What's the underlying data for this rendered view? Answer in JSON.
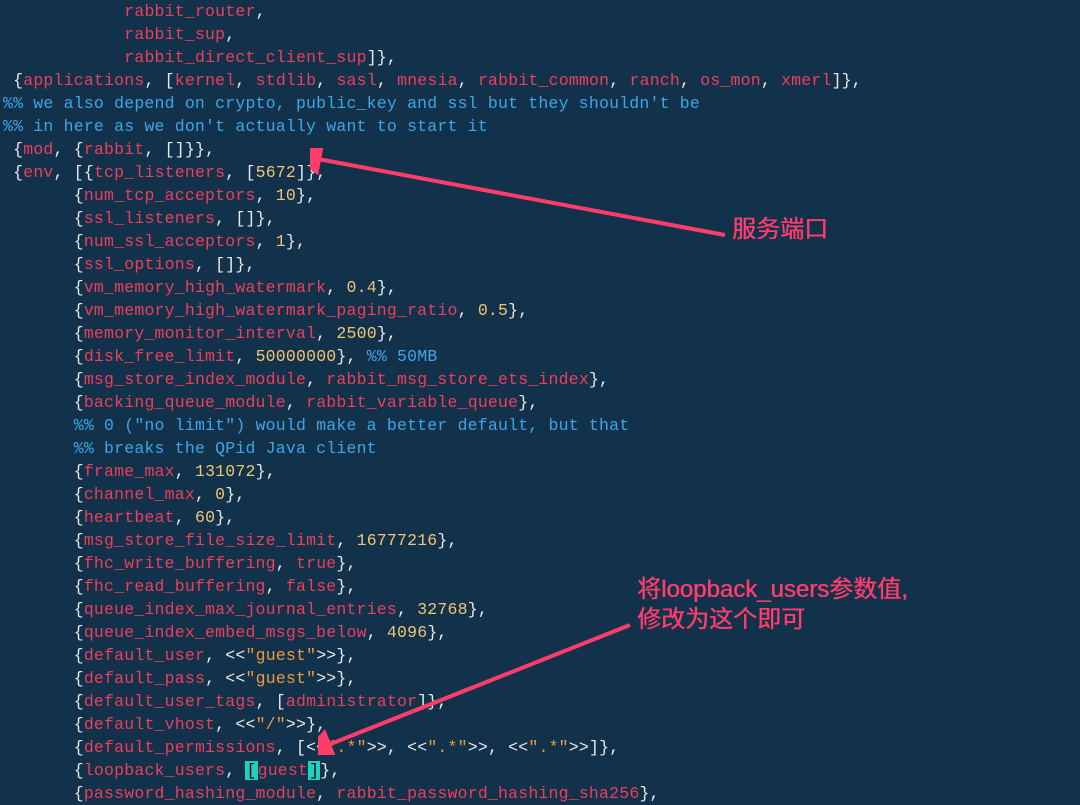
{
  "annotations": {
    "note1": "服务端口",
    "note2_line1": "将loopback_users参数值,",
    "note2_line2": "修改为这个即可"
  },
  "config": {
    "applications": [
      "kernel",
      "stdlib",
      "sasl",
      "mnesia",
      "rabbit_common",
      "ranch",
      "os_mon",
      "xmerl"
    ],
    "mod": "rabbit",
    "env": {
      "tcp_listeners": [
        5672
      ],
      "num_tcp_acceptors": 10,
      "ssl_listeners": [],
      "num_ssl_acceptors": 1,
      "ssl_options": [],
      "vm_memory_high_watermark": 0.4,
      "vm_memory_high_watermark_paging_ratio": 0.5,
      "memory_monitor_interval": 2500,
      "disk_free_limit": 50000000,
      "msg_store_index_module": "rabbit_msg_store_ets_index",
      "backing_queue_module": "rabbit_variable_queue",
      "frame_max": 131072,
      "channel_max": 0,
      "heartbeat": 60,
      "msg_store_file_size_limit": 16777216,
      "fhc_write_buffering": true,
      "fhc_read_buffering": false,
      "queue_index_max_journal_entries": 32768,
      "queue_index_embed_msgs_below": 4096,
      "default_user": "guest",
      "default_pass": "guest",
      "default_user_tags": [
        "administrator"
      ],
      "default_vhost": "/",
      "default_permissions": [
        ".*",
        ".*",
        ".*"
      ],
      "loopback_users": [
        "guest"
      ],
      "password_hashing_module": "rabbit_password_hashing_sha256"
    }
  },
  "code_lines": [
    [
      [
        "            ",
        "w"
      ],
      [
        "rabbit_router",
        "r"
      ],
      [
        ",",
        "w"
      ]
    ],
    [
      [
        "            ",
        "w"
      ],
      [
        "rabbit_sup",
        "r"
      ],
      [
        ",",
        "w"
      ]
    ],
    [
      [
        "            ",
        "w"
      ],
      [
        "rabbit_direct_client_sup",
        "r"
      ],
      [
        "]},",
        "w"
      ]
    ],
    [
      [
        " ",
        "w"
      ],
      [
        "{",
        "w"
      ],
      [
        "applications",
        "r"
      ],
      [
        ", [",
        "w"
      ],
      [
        "kernel",
        "r"
      ],
      [
        ", ",
        "w"
      ],
      [
        "stdlib",
        "r"
      ],
      [
        ", ",
        "w"
      ],
      [
        "sasl",
        "r"
      ],
      [
        ", ",
        "w"
      ],
      [
        "mnesia",
        "r"
      ],
      [
        ", ",
        "w"
      ],
      [
        "rabbit_common",
        "r"
      ],
      [
        ", ",
        "w"
      ],
      [
        "ranch",
        "r"
      ],
      [
        ", ",
        "w"
      ],
      [
        "os_mon",
        "r"
      ],
      [
        ", ",
        "w"
      ],
      [
        "xmerl",
        "r"
      ],
      [
        "]},",
        "w"
      ]
    ],
    [
      [
        "%% we also depend on crypto, public_key and ssl but they shouldn't be",
        "b"
      ]
    ],
    [
      [
        "%% in here as we don't actually want to start it",
        "b"
      ]
    ],
    [
      [
        " ",
        "w"
      ],
      [
        "{",
        "w"
      ],
      [
        "mod",
        "r"
      ],
      [
        ", {",
        "w"
      ],
      [
        "rabbit",
        "r"
      ],
      [
        ", []",
        "w"
      ],
      [
        "}},",
        "w"
      ]
    ],
    [
      [
        " ",
        "w"
      ],
      [
        "{",
        "w"
      ],
      [
        "env",
        "r"
      ],
      [
        ", [{",
        "w"
      ],
      [
        "tcp_listeners",
        "r"
      ],
      [
        ", [",
        "w"
      ],
      [
        "5672",
        "y"
      ],
      [
        "]},",
        "w"
      ]
    ],
    [
      [
        "       {",
        "w"
      ],
      [
        "num_tcp_acceptors",
        "r"
      ],
      [
        ", ",
        "w"
      ],
      [
        "10",
        "y"
      ],
      [
        "},",
        "w"
      ]
    ],
    [
      [
        "       {",
        "w"
      ],
      [
        "ssl_listeners",
        "r"
      ],
      [
        ", []",
        "w"
      ],
      [
        "},",
        "w"
      ]
    ],
    [
      [
        "       {",
        "w"
      ],
      [
        "num_ssl_acceptors",
        "r"
      ],
      [
        ", ",
        "w"
      ],
      [
        "1",
        "y"
      ],
      [
        "},",
        "w"
      ]
    ],
    [
      [
        "       {",
        "w"
      ],
      [
        "ssl_options",
        "r"
      ],
      [
        ", []",
        "w"
      ],
      [
        "},",
        "w"
      ]
    ],
    [
      [
        "       {",
        "w"
      ],
      [
        "vm_memory_high_watermark",
        "r"
      ],
      [
        ", ",
        "w"
      ],
      [
        "0.4",
        "y"
      ],
      [
        "},",
        "w"
      ]
    ],
    [
      [
        "       {",
        "w"
      ],
      [
        "vm_memory_high_watermark_paging_ratio",
        "r"
      ],
      [
        ", ",
        "w"
      ],
      [
        "0.5",
        "y"
      ],
      [
        "},",
        "w"
      ]
    ],
    [
      [
        "       {",
        "w"
      ],
      [
        "memory_monitor_interval",
        "r"
      ],
      [
        ", ",
        "w"
      ],
      [
        "2500",
        "y"
      ],
      [
        "},",
        "w"
      ]
    ],
    [
      [
        "       {",
        "w"
      ],
      [
        "disk_free_limit",
        "r"
      ],
      [
        ", ",
        "w"
      ],
      [
        "50000000",
        "y"
      ],
      [
        "}, ",
        "w"
      ],
      [
        "%% 50MB",
        "b"
      ]
    ],
    [
      [
        "       {",
        "w"
      ],
      [
        "msg_store_index_module",
        "r"
      ],
      [
        ", ",
        "w"
      ],
      [
        "rabbit_msg_store_ets_index",
        "r"
      ],
      [
        "},",
        "w"
      ]
    ],
    [
      [
        "       {",
        "w"
      ],
      [
        "backing_queue_module",
        "r"
      ],
      [
        ", ",
        "w"
      ],
      [
        "rabbit_variable_queue",
        "r"
      ],
      [
        "},",
        "w"
      ]
    ],
    [
      [
        "       ",
        "w"
      ],
      [
        "%% 0 (\"no limit\") would make a better default, but that",
        "b"
      ]
    ],
    [
      [
        "       ",
        "w"
      ],
      [
        "%% breaks the QPid Java client",
        "b"
      ]
    ],
    [
      [
        "       {",
        "w"
      ],
      [
        "frame_max",
        "r"
      ],
      [
        ", ",
        "w"
      ],
      [
        "131072",
        "y"
      ],
      [
        "},",
        "w"
      ]
    ],
    [
      [
        "       {",
        "w"
      ],
      [
        "channel_max",
        "r"
      ],
      [
        ", ",
        "w"
      ],
      [
        "0",
        "y"
      ],
      [
        "},",
        "w"
      ]
    ],
    [
      [
        "       {",
        "w"
      ],
      [
        "heartbeat",
        "r"
      ],
      [
        ", ",
        "w"
      ],
      [
        "60",
        "y"
      ],
      [
        "},",
        "w"
      ]
    ],
    [
      [
        "       {",
        "w"
      ],
      [
        "msg_store_file_size_limit",
        "r"
      ],
      [
        ", ",
        "w"
      ],
      [
        "16777216",
        "y"
      ],
      [
        "},",
        "w"
      ]
    ],
    [
      [
        "       {",
        "w"
      ],
      [
        "fhc_write_buffering",
        "r"
      ],
      [
        ", ",
        "w"
      ],
      [
        "true",
        "r"
      ],
      [
        "},",
        "w"
      ]
    ],
    [
      [
        "       {",
        "w"
      ],
      [
        "fhc_read_buffering",
        "r"
      ],
      [
        ", ",
        "w"
      ],
      [
        "false",
        "r"
      ],
      [
        "},",
        "w"
      ]
    ],
    [
      [
        "       {",
        "w"
      ],
      [
        "queue_index_max_journal_entries",
        "r"
      ],
      [
        ", ",
        "w"
      ],
      [
        "32768",
        "y"
      ],
      [
        "},",
        "w"
      ]
    ],
    [
      [
        "       {",
        "w"
      ],
      [
        "queue_index_embed_msgs_below",
        "r"
      ],
      [
        ", ",
        "w"
      ],
      [
        "4096",
        "y"
      ],
      [
        "},",
        "w"
      ]
    ],
    [
      [
        "       {",
        "w"
      ],
      [
        "default_user",
        "r"
      ],
      [
        ", <<",
        "w"
      ],
      [
        "\"guest\"",
        "o"
      ],
      [
        ">>",
        "w"
      ],
      [
        "},",
        "w"
      ]
    ],
    [
      [
        "       {",
        "w"
      ],
      [
        "default_pass",
        "r"
      ],
      [
        ", <<",
        "w"
      ],
      [
        "\"guest\"",
        "o"
      ],
      [
        ">>",
        "w"
      ],
      [
        "},",
        "w"
      ]
    ],
    [
      [
        "       {",
        "w"
      ],
      [
        "default_user_tags",
        "r"
      ],
      [
        ", [",
        "w"
      ],
      [
        "administrator",
        "r"
      ],
      [
        "]},",
        "w"
      ]
    ],
    [
      [
        "       {",
        "w"
      ],
      [
        "default_vhost",
        "r"
      ],
      [
        ", <<",
        "w"
      ],
      [
        "\"/\"",
        "o"
      ],
      [
        ">>",
        "w"
      ],
      [
        "},",
        "w"
      ]
    ],
    [
      [
        "       {",
        "w"
      ],
      [
        "default_permissions",
        "r"
      ],
      [
        ", [<<",
        "w"
      ],
      [
        "\".*\"",
        "o"
      ],
      [
        ">>, <<",
        "w"
      ],
      [
        "\".*\"",
        "o"
      ],
      [
        ">>, <<",
        "w"
      ],
      [
        "\".*\"",
        "o"
      ],
      [
        ">>]},",
        "w"
      ]
    ],
    [
      [
        "       {",
        "w"
      ],
      [
        "loopback_users",
        "r"
      ],
      [
        ", ",
        "w"
      ],
      [
        "[",
        "hi"
      ],
      [
        "guest",
        "r"
      ],
      [
        "]",
        "hi"
      ],
      [
        "},",
        "w"
      ]
    ],
    [
      [
        "       {",
        "w"
      ],
      [
        "password_hashing_module",
        "r"
      ],
      [
        ", ",
        "w"
      ],
      [
        "rabbit_password_hashing_sha256",
        "r"
      ],
      [
        "},",
        "w"
      ]
    ]
  ]
}
